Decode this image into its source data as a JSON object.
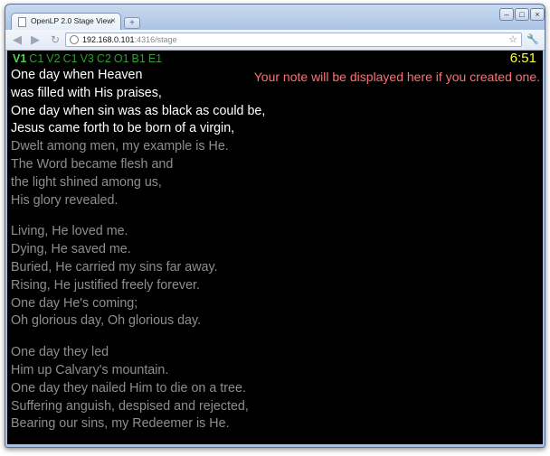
{
  "browser": {
    "tab_title": "OpenLP 2.0 Stage View",
    "url_host": "192.168.0.101",
    "url_rest": ":4316/stage"
  },
  "stage": {
    "verse_order": [
      {
        "label": "V1",
        "current": true
      },
      {
        "label": "C1",
        "current": false
      },
      {
        "label": "V2",
        "current": false
      },
      {
        "label": "C1",
        "current": false
      },
      {
        "label": "V3",
        "current": false
      },
      {
        "label": "C2",
        "current": false
      },
      {
        "label": "O1",
        "current": false
      },
      {
        "label": "B1",
        "current": false
      },
      {
        "label": "E1",
        "current": false
      }
    ],
    "clock": "6:51",
    "note": "Your note will be displayed here if you created one.",
    "current_lines": [
      "One day when Heaven",
      "was filled with His praises,",
      "One day when sin was as black as could be,",
      "Jesus came forth to be born of a virgin,"
    ],
    "upcoming_stanzas": [
      [
        "Dwelt among men, my example is He.",
        "The Word became flesh and",
        "the light shined among us,",
        "His glory revealed."
      ],
      [
        "Living, He loved me.",
        "Dying, He saved me.",
        "Buried, He carried my sins far away.",
        "Rising, He justified freely forever.",
        "One day He's coming;",
        "Oh glorious day, Oh glorious day."
      ],
      [
        "One day they led",
        "Him up Calvary's mountain.",
        "One day they nailed Him to die on a tree.",
        "Suffering anguish, despised and rejected,",
        "Bearing our sins, my Redeemer is He."
      ]
    ],
    "colors": {
      "background": "#000000",
      "current_text": "#ffffff",
      "upcoming_text": "#8e8e8e",
      "verse_tag": "#2f9f2f",
      "clock": "#ffff33",
      "note": "#ff7070"
    }
  }
}
